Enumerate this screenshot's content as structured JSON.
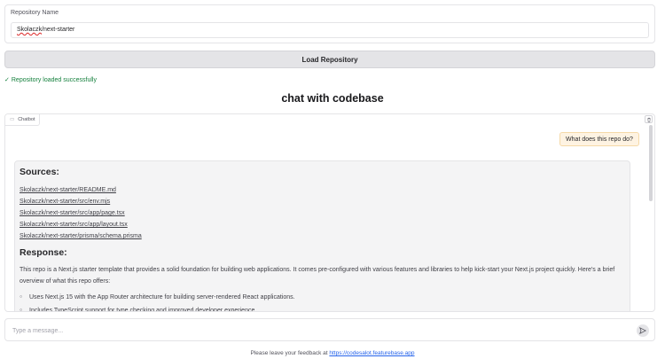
{
  "repo": {
    "label": "Repository Name",
    "value_owner": "Skolaczk",
    "value_rest": "/next-starter"
  },
  "load_button": {
    "label": "Load Repository"
  },
  "status": {
    "icon": "check-icon",
    "text": "Repository loaded successfully",
    "color": "#15803d"
  },
  "page_title": "chat with codebase",
  "chat": {
    "tag_label": "Chatbot",
    "user_message": "What does this repo do?",
    "bot": {
      "sources_heading": "Sources:",
      "sources": [
        "Skolaczk/next-starter/README.md",
        "Skolaczk/next-starter/src/env.mjs",
        "Skolaczk/next-starter/src/app/page.tsx",
        "Skolaczk/next-starter/src/app/layout.tsx",
        "Skolaczk/next-starter/prisma/schema.prisma"
      ],
      "response_heading": "Response:",
      "response_text": "This repo is a Next.js starter template that provides a solid foundation for building web applications. It comes pre-configured with various features and libraries to help kick-start your Next.js project quickly. Here's a brief overview of what this repo offers:",
      "bullets": [
        "Uses Next.js 15 with the App Router architecture for building server-rendered React applications.",
        "Includes TypeScript support for type checking and improved developer experience."
      ]
    }
  },
  "message_input": {
    "placeholder": "Type a message..."
  },
  "footer": {
    "text": "Please leave your feedback at",
    "link": "https://codesalot.featurebase.app"
  }
}
